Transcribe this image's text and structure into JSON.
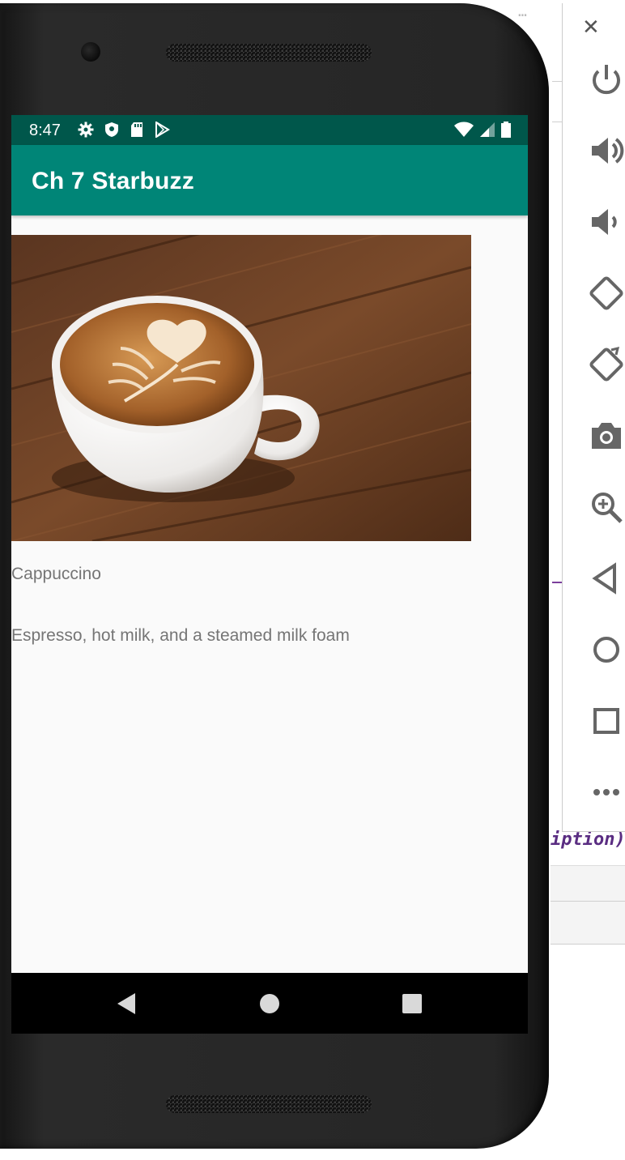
{
  "status_bar": {
    "time": "8:47",
    "left_icons": [
      "gear-icon",
      "shield-icon",
      "sd-card-icon",
      "play-store-icon"
    ],
    "right_icons": [
      "wifi-icon",
      "cell-signal-icon",
      "battery-icon"
    ]
  },
  "app_bar": {
    "title": "Ch 7 Starbuzz"
  },
  "drink": {
    "image": "cappuccino-photo",
    "name": "Cappuccino",
    "description": "Espresso, hot milk, and a steamed milk foam"
  },
  "nav_bar": {
    "buttons": [
      "back-icon",
      "home-icon",
      "recents-icon"
    ]
  },
  "emulator_panel": {
    "buttons": [
      "close-icon",
      "power-icon",
      "volume-up-icon",
      "volume-down-icon",
      "rotate-left-icon",
      "rotate-right-icon",
      "camera-icon",
      "zoom-icon",
      "back-icon",
      "home-icon",
      "overview-icon",
      "more-icon"
    ]
  },
  "background_ide": {
    "code_fragment": "iption)"
  },
  "colors": {
    "status_bar": "#00574b",
    "app_bar": "#008577",
    "screen_bg": "#fafafa",
    "text": "#757575",
    "nav_bar": "#000000",
    "ide_code": "#5a2d82"
  }
}
